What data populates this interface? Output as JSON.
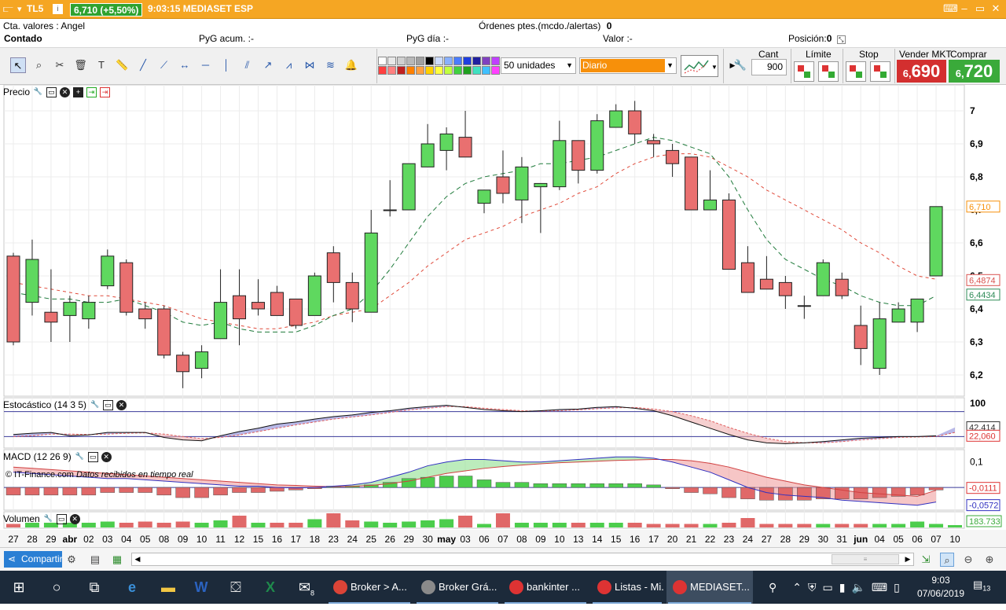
{
  "window": {
    "symbol": "TL5",
    "price_badge": "6,710 (+5,50%)",
    "time_name": "9:03:15 MEDIASET ESP",
    "controls": [
      "▭",
      "‒",
      "▭",
      "✕"
    ]
  },
  "account": {
    "cta": "Cta. valores : Angel",
    "ordenes": "Órdenes ptes.(mcdo./alertas)",
    "ordenes_value": "0",
    "contado": "Contado",
    "pyg_acum": "PyG acum. :-",
    "pyg_dia": "PyG día :-",
    "valor": "Valor :-",
    "posicion": "Posición:",
    "posicion_value": "0"
  },
  "toolbar": {
    "tools": [
      "cursor-icon",
      "zoom-icon",
      "tools-icon",
      "trash-icon",
      "text-icon",
      "ruler-icon",
      "line-icon",
      "trendline-icon",
      "segment-icon",
      "hline-icon",
      "vline-icon",
      "channel-icon",
      "arrow-icon",
      "zigzag-icon",
      "fibonacci-icon",
      "regression-icon",
      "alert-bell-icon"
    ],
    "swatch_colors": [
      "#ffffff",
      "#e8e8e8",
      "#d0d0d0",
      "#b8b8b8",
      "#a0a0a0",
      "#000000",
      "#ccdcff",
      "#88b0ff",
      "#4a7cff",
      "#1e3ee0",
      "#2020a0",
      "#8040c0",
      "#c040ff",
      "#ff4040",
      "#ff8080",
      "#c02020",
      "#ff8000",
      "#ffa040",
      "#ffd000",
      "#ffff40",
      "#c0ff40",
      "#40d040",
      "#20a020",
      "#40e0c0",
      "#40c0ff",
      "#ff40ff"
    ],
    "units": "50 unidades",
    "period": "Diario",
    "cant_label": "Cant",
    "cant_value": "900",
    "limite_label": "Límite",
    "stop_label": "Stop",
    "vender_label": "Vender MKT",
    "comprar_label": "Comprar MKT",
    "sell_price_small": "6,",
    "sell_price_big": "690",
    "buy_price_small": "6,",
    "buy_price_big": "720"
  },
  "panels": {
    "price_title": "Precio",
    "stoch_title": "Estocástico (14 3 5)",
    "macd_title": "MACD (12 26 9)",
    "volume_title": "Volumen",
    "credit_source": "© IT-Finance.com",
    "credit_note": "Datos recibidos en tiempo real"
  },
  "chart_data": [
    {
      "type": "candlestick",
      "title": "Precio",
      "x_labels": [
        "27",
        "28",
        "29",
        "abr",
        "02",
        "03",
        "04",
        "05",
        "08",
        "09",
        "10",
        "11",
        "12",
        "15",
        "16",
        "17",
        "18",
        "23",
        "24",
        "25",
        "26",
        "29",
        "30",
        "may",
        "03",
        "06",
        "07",
        "08",
        "09",
        "10",
        "13",
        "14",
        "15",
        "16",
        "17",
        "20",
        "21",
        "22",
        "23",
        "24",
        "27",
        "28",
        "29",
        "30",
        "31",
        "jun",
        "04",
        "05",
        "06",
        "07",
        "10"
      ],
      "ohlc": [
        [
          6.56,
          6.57,
          6.29,
          6.3
        ],
        [
          6.42,
          6.61,
          6.38,
          6.55
        ],
        [
          6.39,
          6.52,
          6.3,
          6.36
        ],
        [
          6.38,
          6.44,
          6.3,
          6.42
        ],
        [
          6.37,
          6.44,
          6.34,
          6.42
        ],
        [
          6.47,
          6.58,
          6.46,
          6.56
        ],
        [
          6.54,
          6.55,
          6.38,
          6.39
        ],
        [
          6.4,
          6.42,
          6.34,
          6.37
        ],
        [
          6.4,
          6.41,
          6.25,
          6.26
        ],
        [
          6.26,
          6.27,
          6.16,
          6.21
        ],
        [
          6.22,
          6.29,
          6.19,
          6.27
        ],
        [
          6.31,
          6.52,
          6.31,
          6.42
        ],
        [
          6.44,
          6.52,
          6.29,
          6.37
        ],
        [
          6.42,
          6.49,
          6.38,
          6.4
        ],
        [
          6.45,
          6.47,
          6.38,
          6.38
        ],
        [
          6.43,
          6.43,
          6.34,
          6.35
        ],
        [
          6.38,
          6.51,
          6.38,
          6.5
        ],
        [
          6.57,
          6.59,
          6.42,
          6.48
        ],
        [
          6.48,
          6.51,
          6.36,
          6.4
        ],
        [
          6.39,
          6.7,
          6.39,
          6.63
        ],
        [
          6.7,
          6.79,
          6.68,
          6.7
        ],
        [
          6.7,
          6.84,
          6.7,
          6.84
        ],
        [
          6.83,
          6.96,
          6.83,
          6.9
        ],
        [
          6.88,
          6.95,
          6.82,
          6.93
        ],
        [
          6.92,
          7.0,
          6.87,
          6.86
        ],
        [
          6.72,
          6.76,
          6.69,
          6.76
        ],
        [
          6.8,
          6.88,
          6.72,
          6.75
        ],
        [
          6.73,
          6.86,
          6.66,
          6.83
        ],
        [
          6.77,
          6.78,
          6.63,
          6.78
        ],
        [
          6.77,
          6.97,
          6.76,
          6.91
        ],
        [
          6.91,
          6.91,
          6.78,
          6.82
        ],
        [
          6.82,
          6.99,
          6.81,
          6.97
        ],
        [
          6.95,
          7.02,
          6.95,
          7.0
        ],
        [
          7.0,
          7.03,
          6.9,
          6.93
        ],
        [
          6.91,
          6.93,
          6.86,
          6.9
        ],
        [
          6.88,
          6.9,
          6.8,
          6.84
        ],
        [
          6.86,
          6.86,
          6.7,
          6.7
        ],
        [
          6.7,
          6.82,
          6.7,
          6.73
        ],
        [
          6.73,
          6.75,
          6.52,
          6.52
        ],
        [
          6.54,
          6.59,
          6.45,
          6.45
        ],
        [
          6.49,
          6.56,
          6.46,
          6.46
        ],
        [
          6.48,
          6.5,
          6.4,
          6.44
        ],
        [
          6.41,
          6.44,
          6.37,
          6.41
        ],
        [
          6.44,
          6.55,
          6.44,
          6.54
        ],
        [
          6.49,
          6.51,
          6.43,
          6.44
        ],
        [
          6.35,
          6.41,
          6.23,
          6.28
        ],
        [
          6.22,
          6.42,
          6.2,
          6.37
        ],
        [
          6.36,
          6.42,
          6.36,
          6.4
        ],
        [
          6.36,
          6.43,
          6.33,
          6.43
        ],
        [
          6.5,
          6.71,
          6.5,
          6.71
        ]
      ],
      "ma_green_dashed": [
        6.45,
        6.44,
        6.43,
        6.43,
        6.42,
        6.42,
        6.43,
        6.41,
        6.39,
        6.36,
        6.35,
        6.36,
        6.34,
        6.33,
        6.33,
        6.33,
        6.35,
        6.38,
        6.4,
        6.45,
        6.52,
        6.6,
        6.68,
        6.74,
        6.78,
        6.8,
        6.81,
        6.82,
        6.84,
        6.84,
        6.85,
        6.86,
        6.88,
        6.9,
        6.92,
        6.91,
        6.89,
        6.87,
        6.8,
        6.7,
        6.61,
        6.55,
        6.52,
        6.49,
        6.47,
        6.44,
        6.42,
        6.41,
        6.41,
        6.44
      ],
      "ma_red_dashed": [
        6.48,
        6.47,
        6.46,
        6.45,
        6.44,
        6.44,
        6.43,
        6.42,
        6.41,
        6.39,
        6.37,
        6.36,
        6.35,
        6.34,
        6.34,
        6.35,
        6.36,
        6.38,
        6.39,
        6.4,
        6.44,
        6.48,
        6.53,
        6.57,
        6.61,
        6.63,
        6.65,
        6.68,
        6.7,
        6.72,
        6.75,
        6.77,
        6.81,
        6.84,
        6.86,
        6.87,
        6.87,
        6.86,
        6.83,
        6.8,
        6.76,
        6.73,
        6.7,
        6.67,
        6.64,
        6.6,
        6.57,
        6.53,
        6.5,
        6.49
      ],
      "y_ticks": [
        "7",
        "6,9",
        "6,8",
        "6,7",
        "6,6",
        "6,5",
        "6,4",
        "6,3",
        "6,2"
      ],
      "y_tick_values": [
        7.0,
        6.9,
        6.8,
        6.7,
        6.6,
        6.5,
        6.4,
        6.3,
        6.2
      ],
      "ylim": [
        6.15,
        7.05
      ],
      "markers": [
        {
          "label": "6,710",
          "value": 6.71,
          "color": "#f7900a"
        },
        {
          "label": "6,4874",
          "value": 6.4874,
          "color": "#d9534f"
        },
        {
          "label": "6,4434",
          "value": 6.4434,
          "color": "#2e8b57"
        }
      ]
    },
    {
      "type": "line",
      "title": "Estocástico (14 3 5)",
      "ylim": [
        0,
        100
      ],
      "y_ticks": [
        "100"
      ],
      "markers": [
        {
          "label": "42,414",
          "value": 42.414
        },
        {
          "label": "22,060",
          "value": 22.06
        }
      ],
      "k_values": [
        25,
        28,
        30,
        22,
        24,
        30,
        30,
        30,
        18,
        12,
        10,
        22,
        32,
        40,
        50,
        55,
        62,
        68,
        72,
        78,
        82,
        88,
        92,
        95,
        90,
        85,
        82,
        80,
        82,
        85,
        86,
        90,
        92,
        88,
        82,
        70,
        55,
        40,
        25,
        12,
        5,
        3,
        5,
        8,
        12,
        16,
        18,
        20,
        20,
        22,
        42
      ],
      "d_values": [
        20,
        22,
        26,
        26,
        25,
        26,
        28,
        29,
        26,
        20,
        15,
        18,
        24,
        32,
        40,
        48,
        55,
        62,
        67,
        72,
        78,
        84,
        88,
        92,
        92,
        88,
        85,
        82,
        81,
        82,
        84,
        87,
        89,
        90,
        86,
        80,
        70,
        58,
        42,
        28,
        16,
        8,
        5,
        5,
        8,
        12,
        15,
        18,
        19,
        20,
        30
      ]
    },
    {
      "type": "bar",
      "title": "MACD (12 26 9)",
      "ylim": [
        -0.08,
        0.13
      ],
      "y_ticks": [
        "0,1"
      ],
      "markers": [
        {
          "label": "-0,0111",
          "value": -0.0111
        },
        {
          "label": "-0,0572",
          "value": -0.0572
        }
      ],
      "hist": [
        -0.03,
        -0.03,
        -0.03,
        -0.03,
        -0.03,
        -0.02,
        -0.02,
        -0.02,
        -0.03,
        -0.04,
        -0.04,
        -0.03,
        -0.02,
        -0.02,
        -0.015,
        -0.01,
        -0.005,
        0.005,
        0.005,
        0.01,
        0.02,
        0.035,
        0.04,
        0.045,
        0.045,
        0.03,
        0.02,
        0.02,
        0.015,
        0.015,
        0.015,
        0.015,
        0.015,
        0.015,
        0.01,
        -0.005,
        -0.02,
        -0.025,
        -0.04,
        -0.045,
        -0.05,
        -0.05,
        -0.05,
        -0.045,
        -0.045,
        -0.045,
        -0.04,
        -0.035,
        -0.03,
        -0.01
      ],
      "macd": [
        0.06,
        0.055,
        0.05,
        0.045,
        0.04,
        0.035,
        0.035,
        0.03,
        0.025,
        0.02,
        0.015,
        0.01,
        0.005,
        0.005,
        0.0,
        -0.002,
        0.0,
        0.005,
        0.01,
        0.02,
        0.04,
        0.06,
        0.085,
        0.1,
        0.11,
        0.11,
        0.105,
        0.1,
        0.1,
        0.105,
        0.11,
        0.115,
        0.12,
        0.12,
        0.115,
        0.1,
        0.08,
        0.06,
        0.03,
        0.0,
        -0.02,
        -0.03,
        -0.035,
        -0.04,
        -0.05,
        -0.055,
        -0.06,
        -0.065,
        -0.07,
        -0.0572
      ],
      "signal": [
        0.08,
        0.075,
        0.07,
        0.065,
        0.06,
        0.055,
        0.05,
        0.045,
        0.04,
        0.035,
        0.03,
        0.025,
        0.02,
        0.015,
        0.01,
        0.008,
        0.005,
        0.003,
        0.004,
        0.008,
        0.015,
        0.025,
        0.04,
        0.055,
        0.065,
        0.075,
        0.082,
        0.088,
        0.093,
        0.097,
        0.1,
        0.103,
        0.106,
        0.108,
        0.11,
        0.11,
        0.105,
        0.095,
        0.08,
        0.06,
        0.04,
        0.025,
        0.01,
        0.0,
        -0.01,
        -0.02,
        -0.025,
        -0.03,
        -0.035,
        -0.0111
      ]
    },
    {
      "type": "bar",
      "title": "Volumen",
      "markers": [
        {
          "label": "183.733"
        }
      ],
      "values": [
        3,
        4,
        4,
        4,
        4,
        5,
        4,
        5,
        4,
        5,
        4,
        6,
        10,
        4,
        4,
        4,
        7,
        12,
        6,
        5,
        4,
        5,
        6,
        7,
        10,
        3,
        12,
        4,
        4,
        4,
        4,
        4,
        4,
        4,
        3,
        3,
        3,
        3,
        4,
        8,
        3,
        3,
        3,
        3,
        3,
        3,
        3,
        3,
        5,
        3,
        2
      ],
      "colors": [
        "r",
        "g",
        "g",
        "g",
        "g",
        "g",
        "r",
        "r",
        "r",
        "r",
        "g",
        "g",
        "r",
        "g",
        "r",
        "r",
        "g",
        "r",
        "r",
        "g",
        "g",
        "g",
        "g",
        "g",
        "r",
        "g",
        "r",
        "g",
        "g",
        "g",
        "r",
        "g",
        "g",
        "r",
        "r",
        "r",
        "r",
        "g",
        "r",
        "r",
        "r",
        "r",
        "r",
        "g",
        "r",
        "r",
        "g",
        "g",
        "g",
        "g",
        "g"
      ]
    }
  ],
  "bottombar": {
    "share_label": "Compartir",
    "share_icon": "share-icon"
  },
  "taskbar": {
    "apps": [
      {
        "label": "Broker > A...",
        "color": "#db4437"
      },
      {
        "label": "Broker Grá...",
        "color": "#8a8a8a"
      },
      {
        "label": "bankinter ...",
        "color": "#d33"
      },
      {
        "label": "Listas - Mi...",
        "color": "#d33"
      },
      {
        "label": "MEDIASET...",
        "color": "#d33"
      }
    ],
    "mail_badge": "8",
    "time": "9:03",
    "date": "07/06/2019",
    "notif_count": "13"
  }
}
